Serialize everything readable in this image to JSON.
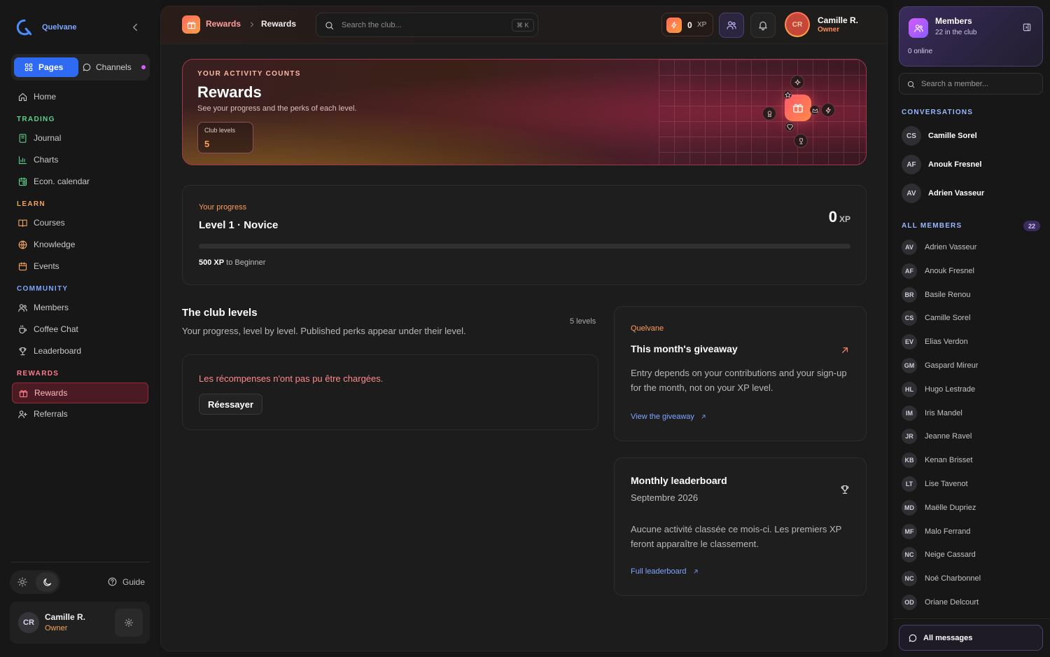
{
  "brand": {
    "name": "Quelvane"
  },
  "sidebar": {
    "segment": {
      "pages": "Pages",
      "channels": "Channels"
    },
    "home": "Home",
    "sections": {
      "trading": "TRADING",
      "learn": "LEARN",
      "community": "COMMUNITY",
      "rewards": "REWARDS"
    },
    "items": {
      "journal": "Journal",
      "charts": "Charts",
      "econ_calendar": "Econ. calendar",
      "courses": "Courses",
      "knowledge": "Knowledge",
      "events": "Events",
      "members": "Members",
      "coffee_chat": "Coffee Chat",
      "leaderboard": "Leaderboard",
      "rewards": "Rewards",
      "referrals": "Referrals"
    },
    "guide": "Guide",
    "user": {
      "initials": "CR",
      "name": "Camille R.",
      "role": "Owner"
    }
  },
  "topbar": {
    "breadcrumb": [
      "Rewards",
      "Rewards"
    ],
    "search_placeholder": "Search the club...",
    "shortcut": "⌘ K",
    "xp": {
      "value": "0",
      "unit": "XP"
    },
    "user": {
      "initials": "CR",
      "name": "Camille R.",
      "role": "Owner"
    }
  },
  "hero": {
    "kicker": "YOUR ACTIVITY COUNTS",
    "title": "Rewards",
    "subtitle": "See your progress and the perks of each level.",
    "stat_label": "Club levels",
    "stat_value": "5"
  },
  "progress": {
    "kicker": "Your progress",
    "level": "Level 1 · Novice",
    "xp_value": "0",
    "xp_unit": "XP",
    "fill_fraction": 0,
    "next_xp": "500 XP",
    "next_text": "to Beginner"
  },
  "levels": {
    "title": "The club levels",
    "subtitle": "Your progress, level by level. Published perks appear under their level.",
    "count": "5 levels",
    "error": "Les récompenses n'ont pas pu être chargées.",
    "retry": "Réessayer"
  },
  "giveaway": {
    "kicker": "Quelvane",
    "title": "This month's giveaway",
    "body": "Entry depends on your contributions and your sign-up for the month, not on your XP level.",
    "link": "View the giveaway"
  },
  "leaderboard": {
    "title": "Monthly leaderboard",
    "month": "Septembre 2026",
    "body": "Aucune activité classée ce mois-ci. Les premiers XP feront apparaître le classement.",
    "link": "Full leaderboard"
  },
  "right_panel": {
    "title": "Members",
    "subtitle": "22 in the club",
    "online": "0 online",
    "search_placeholder": "Search a member...",
    "conversations_label": "CONVERSATIONS",
    "conversations": [
      {
        "initials": "CS",
        "name": "Camille Sorel"
      },
      {
        "initials": "AF",
        "name": "Anouk Fresnel"
      },
      {
        "initials": "AV",
        "name": "Adrien Vasseur"
      }
    ],
    "all_members_label": "ALL MEMBERS",
    "all_members_count": "22",
    "members": [
      {
        "initials": "AV",
        "name": "Adrien Vasseur"
      },
      {
        "initials": "AF",
        "name": "Anouk Fresnel"
      },
      {
        "initials": "BR",
        "name": "Basile Renou"
      },
      {
        "initials": "CS",
        "name": "Camille Sorel"
      },
      {
        "initials": "EV",
        "name": "Elias Verdon"
      },
      {
        "initials": "GM",
        "name": "Gaspard Mireur"
      },
      {
        "initials": "HL",
        "name": "Hugo Lestrade"
      },
      {
        "initials": "IM",
        "name": "Iris Mandel"
      },
      {
        "initials": "JR",
        "name": "Jeanne Ravel"
      },
      {
        "initials": "KB",
        "name": "Kenan Brisset"
      },
      {
        "initials": "LT",
        "name": "Lise Tavenot"
      },
      {
        "initials": "MD",
        "name": "Maëlle Dupriez"
      },
      {
        "initials": "MF",
        "name": "Malo Ferrand"
      },
      {
        "initials": "NC",
        "name": "Neige Cassard"
      },
      {
        "initials": "NC",
        "name": "Noé Charbonnel"
      },
      {
        "initials": "OD",
        "name": "Oriane Delcourt"
      }
    ],
    "all_messages": "All messages"
  }
}
